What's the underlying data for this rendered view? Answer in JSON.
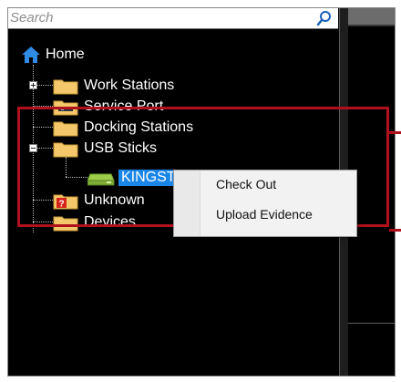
{
  "search": {
    "placeholder": "Search"
  },
  "tree": {
    "root": {
      "label": "Home"
    },
    "items": [
      {
        "label": "Work Stations"
      },
      {
        "label": "Service Port"
      },
      {
        "label": "Docking Stations"
      },
      {
        "label": "USB Sticks"
      },
      {
        "label": "KINGSTON"
      },
      {
        "label": "Unknown"
      },
      {
        "label": "Devices"
      }
    ]
  },
  "context_menu": {
    "items": [
      {
        "label": "Check Out"
      },
      {
        "label": "Upload Evidence"
      }
    ]
  },
  "colors": {
    "background": "#000000",
    "selection": "#1a86e8",
    "highlight_border": "#b0111c",
    "folder": "#f4c86a",
    "home_icon": "#2f8be6"
  }
}
